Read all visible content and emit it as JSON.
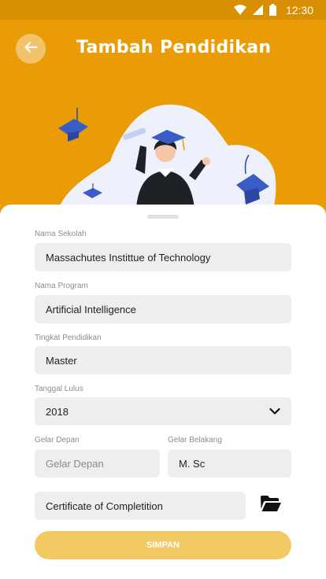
{
  "status_bar": {
    "time": "12:30",
    "icons": [
      "wifi-icon",
      "signal-icon",
      "battery-icon"
    ]
  },
  "header": {
    "title": "Tambah Pendidikan",
    "back_icon": "arrow-left-icon",
    "color": "#e99c06"
  },
  "form": {
    "nama_sekolah": {
      "label": "Nama Sekolah",
      "value": "Massachutes Instittue of Technology"
    },
    "nama_program": {
      "label": "Nama Program",
      "value": "Artificial Intelligence"
    },
    "tingkat_pendidikan": {
      "label": "Tingkat Pendidikan",
      "value": "Master"
    },
    "tanggal_lulus": {
      "label": "Tanggal Lulus",
      "value": "2018"
    },
    "gelar_depan": {
      "label": "Gelar Depan",
      "placeholder": "Gelar Depan"
    },
    "gelar_belakang": {
      "label": "Gelar Belakang",
      "value": "M. Sc"
    },
    "certificate": {
      "value": "Certificate of Completition",
      "icon": "folder-open-icon"
    },
    "save_label": "SIMPAN"
  },
  "colors": {
    "accent": "#e99c06",
    "button": "#f2c962",
    "field_bg": "#eeeeee"
  }
}
